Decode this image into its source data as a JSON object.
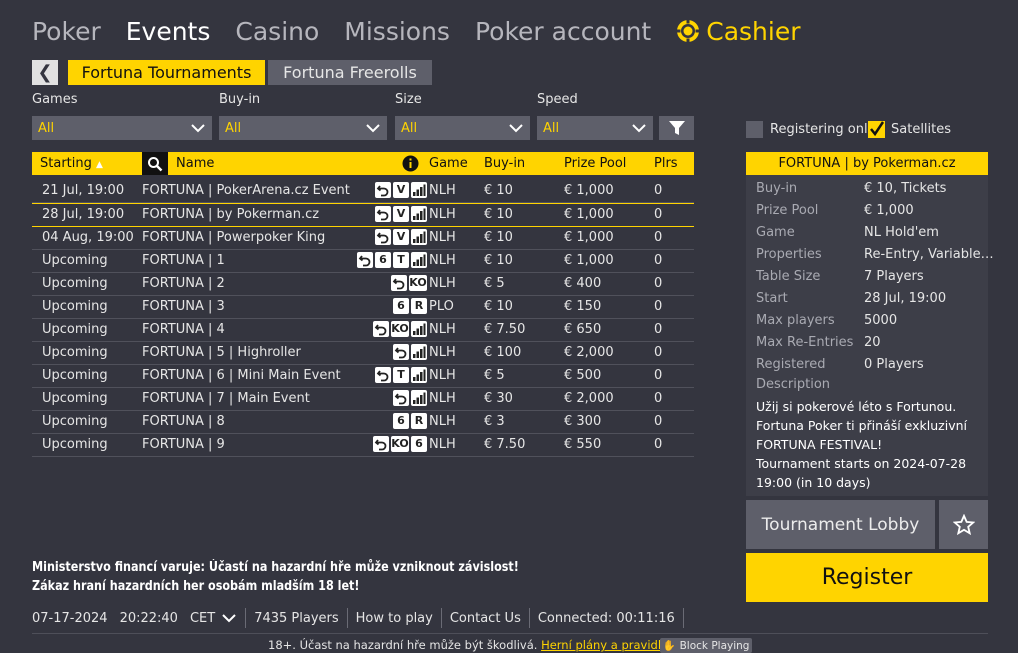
{
  "nav": {
    "items": [
      "Poker",
      "Events",
      "Casino",
      "Missions",
      "Poker account"
    ],
    "active": "Events",
    "cashier": "Cashier"
  },
  "tabs": [
    "Fortuna Tournaments",
    "Fortuna Freerolls"
  ],
  "filters": {
    "labels": [
      "Games",
      "Buy-in",
      "Size",
      "Speed"
    ],
    "values": [
      "All",
      "All",
      "All",
      "All"
    ]
  },
  "table": {
    "headers": {
      "starting": "Starting",
      "name": "Name",
      "game": "Game",
      "buyin": "Buy-in",
      "prize": "Prize Pool",
      "plrs": "Plrs"
    },
    "rows": [
      {
        "start": "21 Jul, 19:00",
        "name": "FORTUNA | PokerArena.cz Event",
        "icons": [
          "reentry-icon",
          "V",
          "speed-icon"
        ],
        "game": "NLH",
        "buyin": "€ 10",
        "prize": "€ 1,000",
        "plrs": "0"
      },
      {
        "start": "28 Jul, 19:00",
        "name": "FORTUNA | by Pokerman.cz",
        "icons": [
          "reentry-icon",
          "V",
          "speed-icon"
        ],
        "game": "NLH",
        "buyin": "€ 10",
        "prize": "€ 1,000",
        "plrs": "0",
        "selected": true
      },
      {
        "start": "04 Aug, 19:00",
        "name": "FORTUNA | Powerpoker King",
        "icons": [
          "reentry-icon",
          "V",
          "speed-icon"
        ],
        "game": "NLH",
        "buyin": "€ 10",
        "prize": "€ 1,000",
        "plrs": "0"
      },
      {
        "start": "Upcoming",
        "name": "FORTUNA | 1",
        "icons": [
          "reentry-icon",
          "6",
          "T",
          "speed-icon"
        ],
        "game": "NLH",
        "buyin": "€ 10",
        "prize": "€ 1,000",
        "plrs": "0"
      },
      {
        "start": "Upcoming",
        "name": "FORTUNA | 2",
        "icons": [
          "reentry-icon",
          "KO"
        ],
        "game": "NLH",
        "buyin": "€ 5",
        "prize": "€ 400",
        "plrs": "0"
      },
      {
        "start": "Upcoming",
        "name": "FORTUNA | 3",
        "icons": [
          "6",
          "R"
        ],
        "game": "PLO",
        "buyin": "€ 10",
        "prize": "€ 150",
        "plrs": "0"
      },
      {
        "start": "Upcoming",
        "name": "FORTUNA | 4",
        "icons": [
          "reentry-icon",
          "KO",
          "speed-icon"
        ],
        "game": "NLH",
        "buyin": "€ 7.50",
        "prize": "€ 650",
        "plrs": "0"
      },
      {
        "start": "Upcoming",
        "name": "FORTUNA | 5 | Highroller",
        "icons": [
          "reentry-icon",
          "speed-icon"
        ],
        "game": "NLH",
        "buyin": "€ 100",
        "prize": "€ 2,000",
        "plrs": "0"
      },
      {
        "start": "Upcoming",
        "name": "FORTUNA | 6 | Mini Main Event",
        "icons": [
          "reentry-icon",
          "T",
          "speed-icon"
        ],
        "game": "NLH",
        "buyin": "€ 5",
        "prize": "€ 500",
        "plrs": "0"
      },
      {
        "start": "Upcoming",
        "name": "FORTUNA | 7 | Main Event",
        "icons": [
          "reentry-icon",
          "speed-icon"
        ],
        "game": "NLH",
        "buyin": "€ 30",
        "prize": "€ 2,000",
        "plrs": "0"
      },
      {
        "start": "Upcoming",
        "name": "FORTUNA | 8",
        "icons": [
          "6",
          "R"
        ],
        "game": "NLH",
        "buyin": "€ 3",
        "prize": "€ 300",
        "plrs": "0"
      },
      {
        "start": "Upcoming",
        "name": "FORTUNA | 9",
        "icons": [
          "reentry-icon",
          "KO",
          "6"
        ],
        "game": "NLH",
        "buyin": "€ 7.50",
        "prize": "€ 550",
        "plrs": "0"
      }
    ]
  },
  "options": {
    "registering_only": "Registering only",
    "satellites": "Satellites"
  },
  "details": {
    "title": "FORTUNA | by Pokerman.cz",
    "rows": [
      {
        "k": "Buy-in",
        "v": "€ 10, Tickets"
      },
      {
        "k": "Prize Pool",
        "v": "€ 1,000"
      },
      {
        "k": "Game",
        "v": "NL Hold'em"
      },
      {
        "k": "Properties",
        "v": "Re-Entry, Variable…"
      },
      {
        "k": "Table Size",
        "v": "7 Players"
      },
      {
        "k": "Start",
        "v": "28 Jul, 19:00"
      },
      {
        "k": "Max players",
        "v": "5000"
      },
      {
        "k": "Max Re-Entries",
        "v": "20"
      },
      {
        "k": "Registered",
        "v": "0 Players"
      }
    ],
    "description_label": "Description",
    "description_lines": [
      "Užij si pokerové léto s Fortunou.",
      "Fortuna Poker ti přináší exkluzivní",
      "FORTUNA FESTIVAL!",
      "Tournament starts on 2024-07-28",
      "19:00 (in 10 days)"
    ],
    "lobby_button": "Tournament Lobby",
    "register_button": "Register"
  },
  "warning": [
    "Ministerstvo financí varuje: Účastí na hazardní hře může vzniknout závislost!",
    "Zákaz hraní hazardních her osobám mladším 18 let!"
  ],
  "status": {
    "date": "07-17-2024",
    "time": "20:22:40",
    "timezone": "CET",
    "players": "7435 Players",
    "how_to_play": "How to play",
    "contact": "Contact Us",
    "connected": "Connected: 00:11:16"
  },
  "footer": {
    "text": "18+. Účast na hazardní hře může být škodlivá.",
    "link": "Herní plány a pravidla.",
    "block": "Block Playing"
  }
}
